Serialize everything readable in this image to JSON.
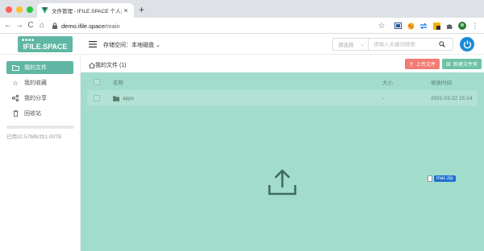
{
  "browser": {
    "tab_title": "文件管理 - IFILE.SPACE 个人云...",
    "tab_close": "×",
    "new_tab": "+",
    "url_host": "demo.ifile.space",
    "url_path": "/main",
    "back": "←",
    "forward": "→",
    "reload": "C",
    "home": "⌂",
    "bookmark": "☆"
  },
  "header": {
    "logo_text": "IFILE.SPACE",
    "logo_dots": "■■■■",
    "storage_label": "存储空间：本地磁盘",
    "storage_chevron": "⌄",
    "search": {
      "select_placeholder": "请选择",
      "select_chevron": "⌄",
      "input_placeholder": "请输入关键词搜索"
    }
  },
  "sidebar": {
    "items": [
      {
        "label": "我的文件",
        "icon": "folder-icon",
        "active": true
      },
      {
        "label": "我的收藏",
        "icon": "star-icon",
        "active": false
      },
      {
        "label": "我的分享",
        "icon": "share-icon",
        "active": false
      },
      {
        "label": "回收站",
        "icon": "trash-icon",
        "active": false
      }
    ],
    "quota_text": "已用32.57MB/共1.00TB",
    "quota_fraction": 0.0
  },
  "main": {
    "breadcrumb": "我的文件 (1)",
    "upload_button": "上传文件",
    "newfolder_button": "新建文件夹",
    "table": {
      "headers": {
        "name": "名称",
        "size": "大小",
        "date": "修改时间"
      },
      "rows": [
        {
          "name": "apps",
          "size": "-",
          "date": "2021-02-22 15:14",
          "type": "folder"
        }
      ]
    },
    "drag_label": "mac.zip"
  },
  "colors": {
    "accent": "#5fb6a4",
    "dropzone": "#a2dccb",
    "upload_button": "#f27b73",
    "newfolder_button": "#6cc3a3",
    "power": "#1a8ad6"
  }
}
